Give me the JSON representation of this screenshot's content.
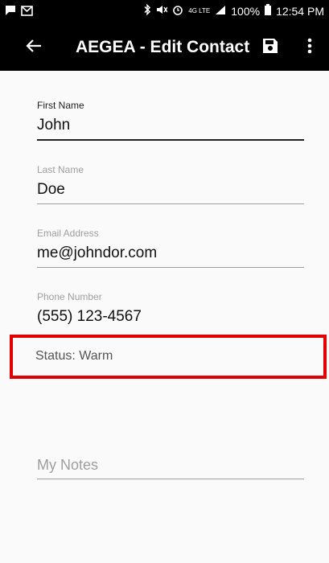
{
  "status_bar": {
    "battery": "100%",
    "time": "12:54 PM",
    "network": "4G LTE"
  },
  "app_bar": {
    "title": "AEGEA - Edit Contact"
  },
  "form": {
    "first_name": {
      "label": "First Name",
      "value": "John"
    },
    "last_name": {
      "label": "Last Name",
      "value": "Doe"
    },
    "email": {
      "label": "Email Address",
      "value": "me@johndor.com"
    },
    "phone": {
      "label": "Phone Number",
      "value": "(555) 123-4567"
    },
    "status": {
      "text": "Status: Warm"
    },
    "notes": {
      "placeholder": "My Notes"
    }
  },
  "colors": {
    "app_bar": "#000000",
    "background": "#fafafa",
    "highlight": "#e00000"
  }
}
